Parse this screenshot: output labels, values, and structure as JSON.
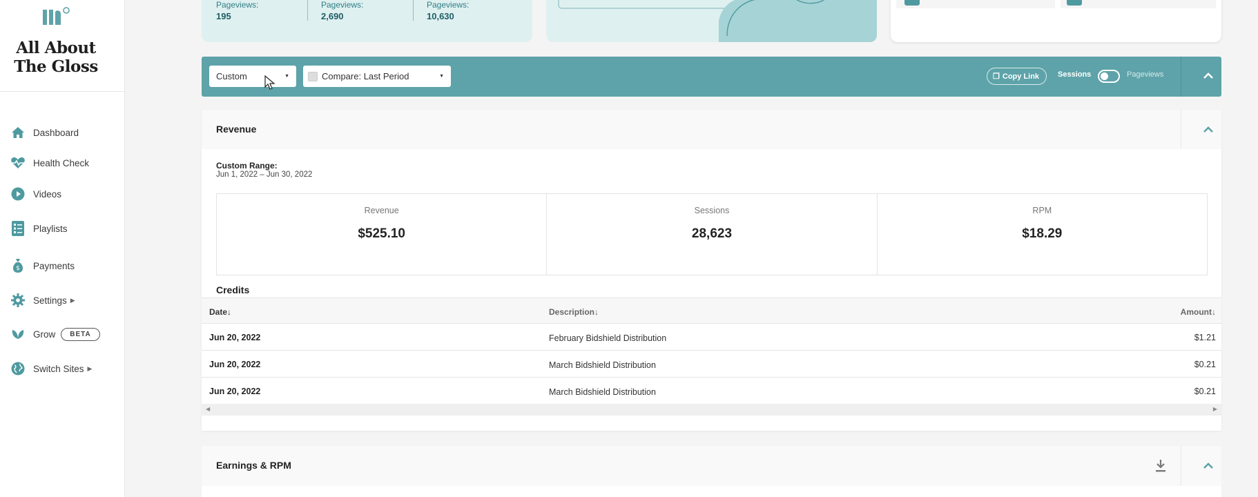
{
  "sidebar": {
    "brand": "All About The Gloss",
    "items": [
      {
        "label": "Dashboard",
        "icon": "home-icon"
      },
      {
        "label": "Health Check",
        "icon": "heartbeat-icon"
      },
      {
        "label": "Videos",
        "icon": "play-icon"
      },
      {
        "label": "Playlists",
        "icon": "list-icon"
      },
      {
        "label": "Payments",
        "icon": "money-bag-icon"
      },
      {
        "label": "Settings",
        "icon": "gear-icon"
      },
      {
        "label": "Grow",
        "icon": "leaf-icon",
        "badge": "BETA"
      },
      {
        "label": "Switch Sites",
        "icon": "globe-icon"
      }
    ]
  },
  "top_cards": {
    "pageviews": [
      {
        "label": "Pageviews:",
        "value": "195"
      },
      {
        "label": "Pageviews:",
        "value": "2,690"
      },
      {
        "label": "Pageviews:",
        "value": "10,630"
      }
    ]
  },
  "filter_bar": {
    "range_select": "Custom",
    "compare_select": "Compare: Last Period",
    "copy_link": "Copy Link",
    "toggle_left": "Sessions",
    "toggle_right": "Pageviews"
  },
  "revenue": {
    "title": "Revenue",
    "range_label": "Custom Range:",
    "range_value": "Jun 1, 2022 – Jun 30, 2022",
    "metrics": [
      {
        "label": "Revenue",
        "value": "$525.10"
      },
      {
        "label": "Sessions",
        "value": "28,623"
      },
      {
        "label": "RPM",
        "value": "$18.29"
      }
    ],
    "credits_title": "Credits",
    "table": {
      "headers": {
        "date": "Date",
        "description": "Description",
        "amount": "Amount"
      },
      "rows": [
        {
          "date": "Jun 20, 2022",
          "description": "February Bidshield Distribution",
          "amount": "$1.21"
        },
        {
          "date": "Jun 20, 2022",
          "description": "March Bidshield Distribution",
          "amount": "$0.21"
        },
        {
          "date": "Jun 20, 2022",
          "description": "March Bidshield Distribution",
          "amount": "$0.21"
        }
      ]
    }
  },
  "earnings": {
    "title": "Earnings & RPM"
  },
  "colors": {
    "teal_bar": "#5ea3a9",
    "teal_card": "#dff0f0",
    "teal_accent": "#4e9aa0"
  }
}
